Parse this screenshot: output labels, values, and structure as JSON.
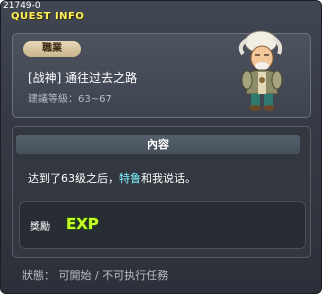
{
  "window": {
    "quest_id": "21749-0",
    "title": "QUEST INFO"
  },
  "quest": {
    "job_badge": "職業",
    "name": "[战神] 通往过去之路",
    "level_label": "建議等級",
    "level_range": "63~67"
  },
  "content": {
    "header": "內容",
    "description_before": "达到了63级之后，",
    "npc_name": "特鲁",
    "description_after": "和我说话。",
    "reward_label": "獎勵",
    "reward_icon": "exp-icon",
    "reward_text": "EXP"
  },
  "status": {
    "label": "狀態",
    "value": "可開始 / 不可执行任務"
  },
  "colors": {
    "title": "#ffef5c",
    "npc_name": "#7df2ff",
    "exp_fill": "#c8ff2a",
    "exp_outline": "#2a6d00"
  }
}
